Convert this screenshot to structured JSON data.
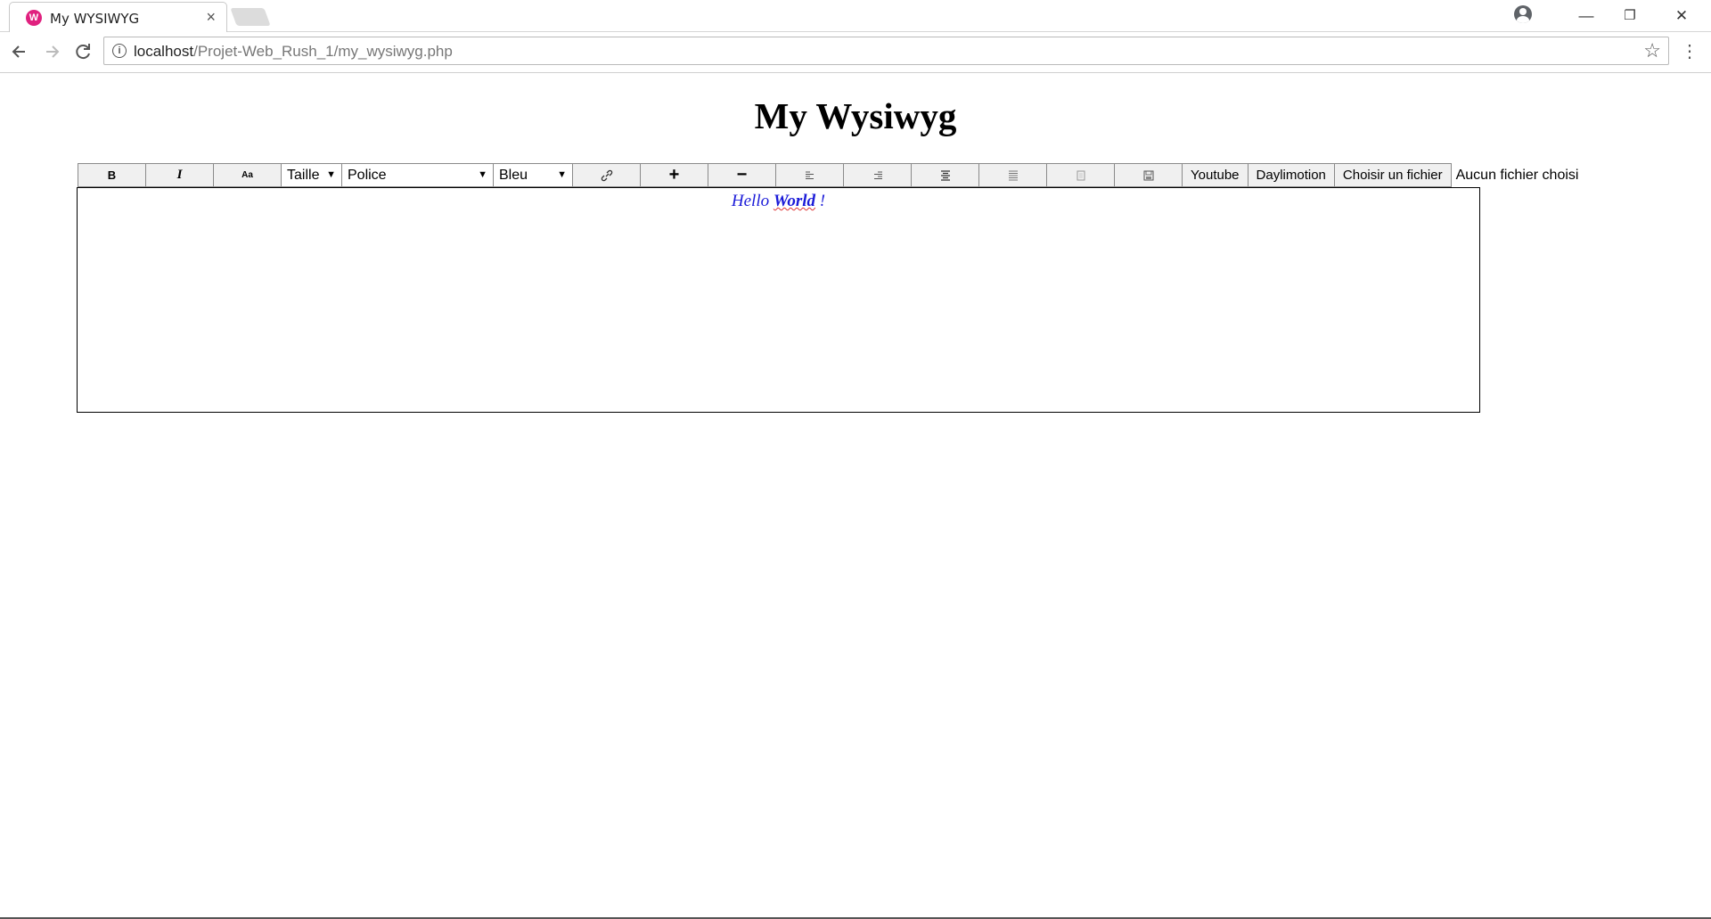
{
  "browser": {
    "tab_title": "My WYSIWYG",
    "tab_favicon": "wamp-icon",
    "close_glyph": "×",
    "url_host": "localhost",
    "url_path": "/Projet-Web_Rush_1/my_wysiwyg.php",
    "minimize_glyph": "—",
    "restore_glyph": "❐",
    "window_close_glyph": "✕"
  },
  "page": {
    "title": "My Wysiwyg",
    "toolbar": {
      "bold_label": "B",
      "italic_label": "I",
      "case_label": "Aa",
      "size_select": "Taille",
      "font_select": "Police",
      "color_select": "Bleu",
      "increase_label": "+",
      "decrease_label": "−",
      "youtube_label": "Youtube",
      "dailymotion_label": "Daylimotion",
      "file_button_label": "Choisir un fichier",
      "file_status": "Aucun fichier choisi"
    },
    "editor": {
      "text_before": "Hello ",
      "text_bold": "World",
      "text_after": " !",
      "text_color": "#1a1ad8"
    }
  }
}
